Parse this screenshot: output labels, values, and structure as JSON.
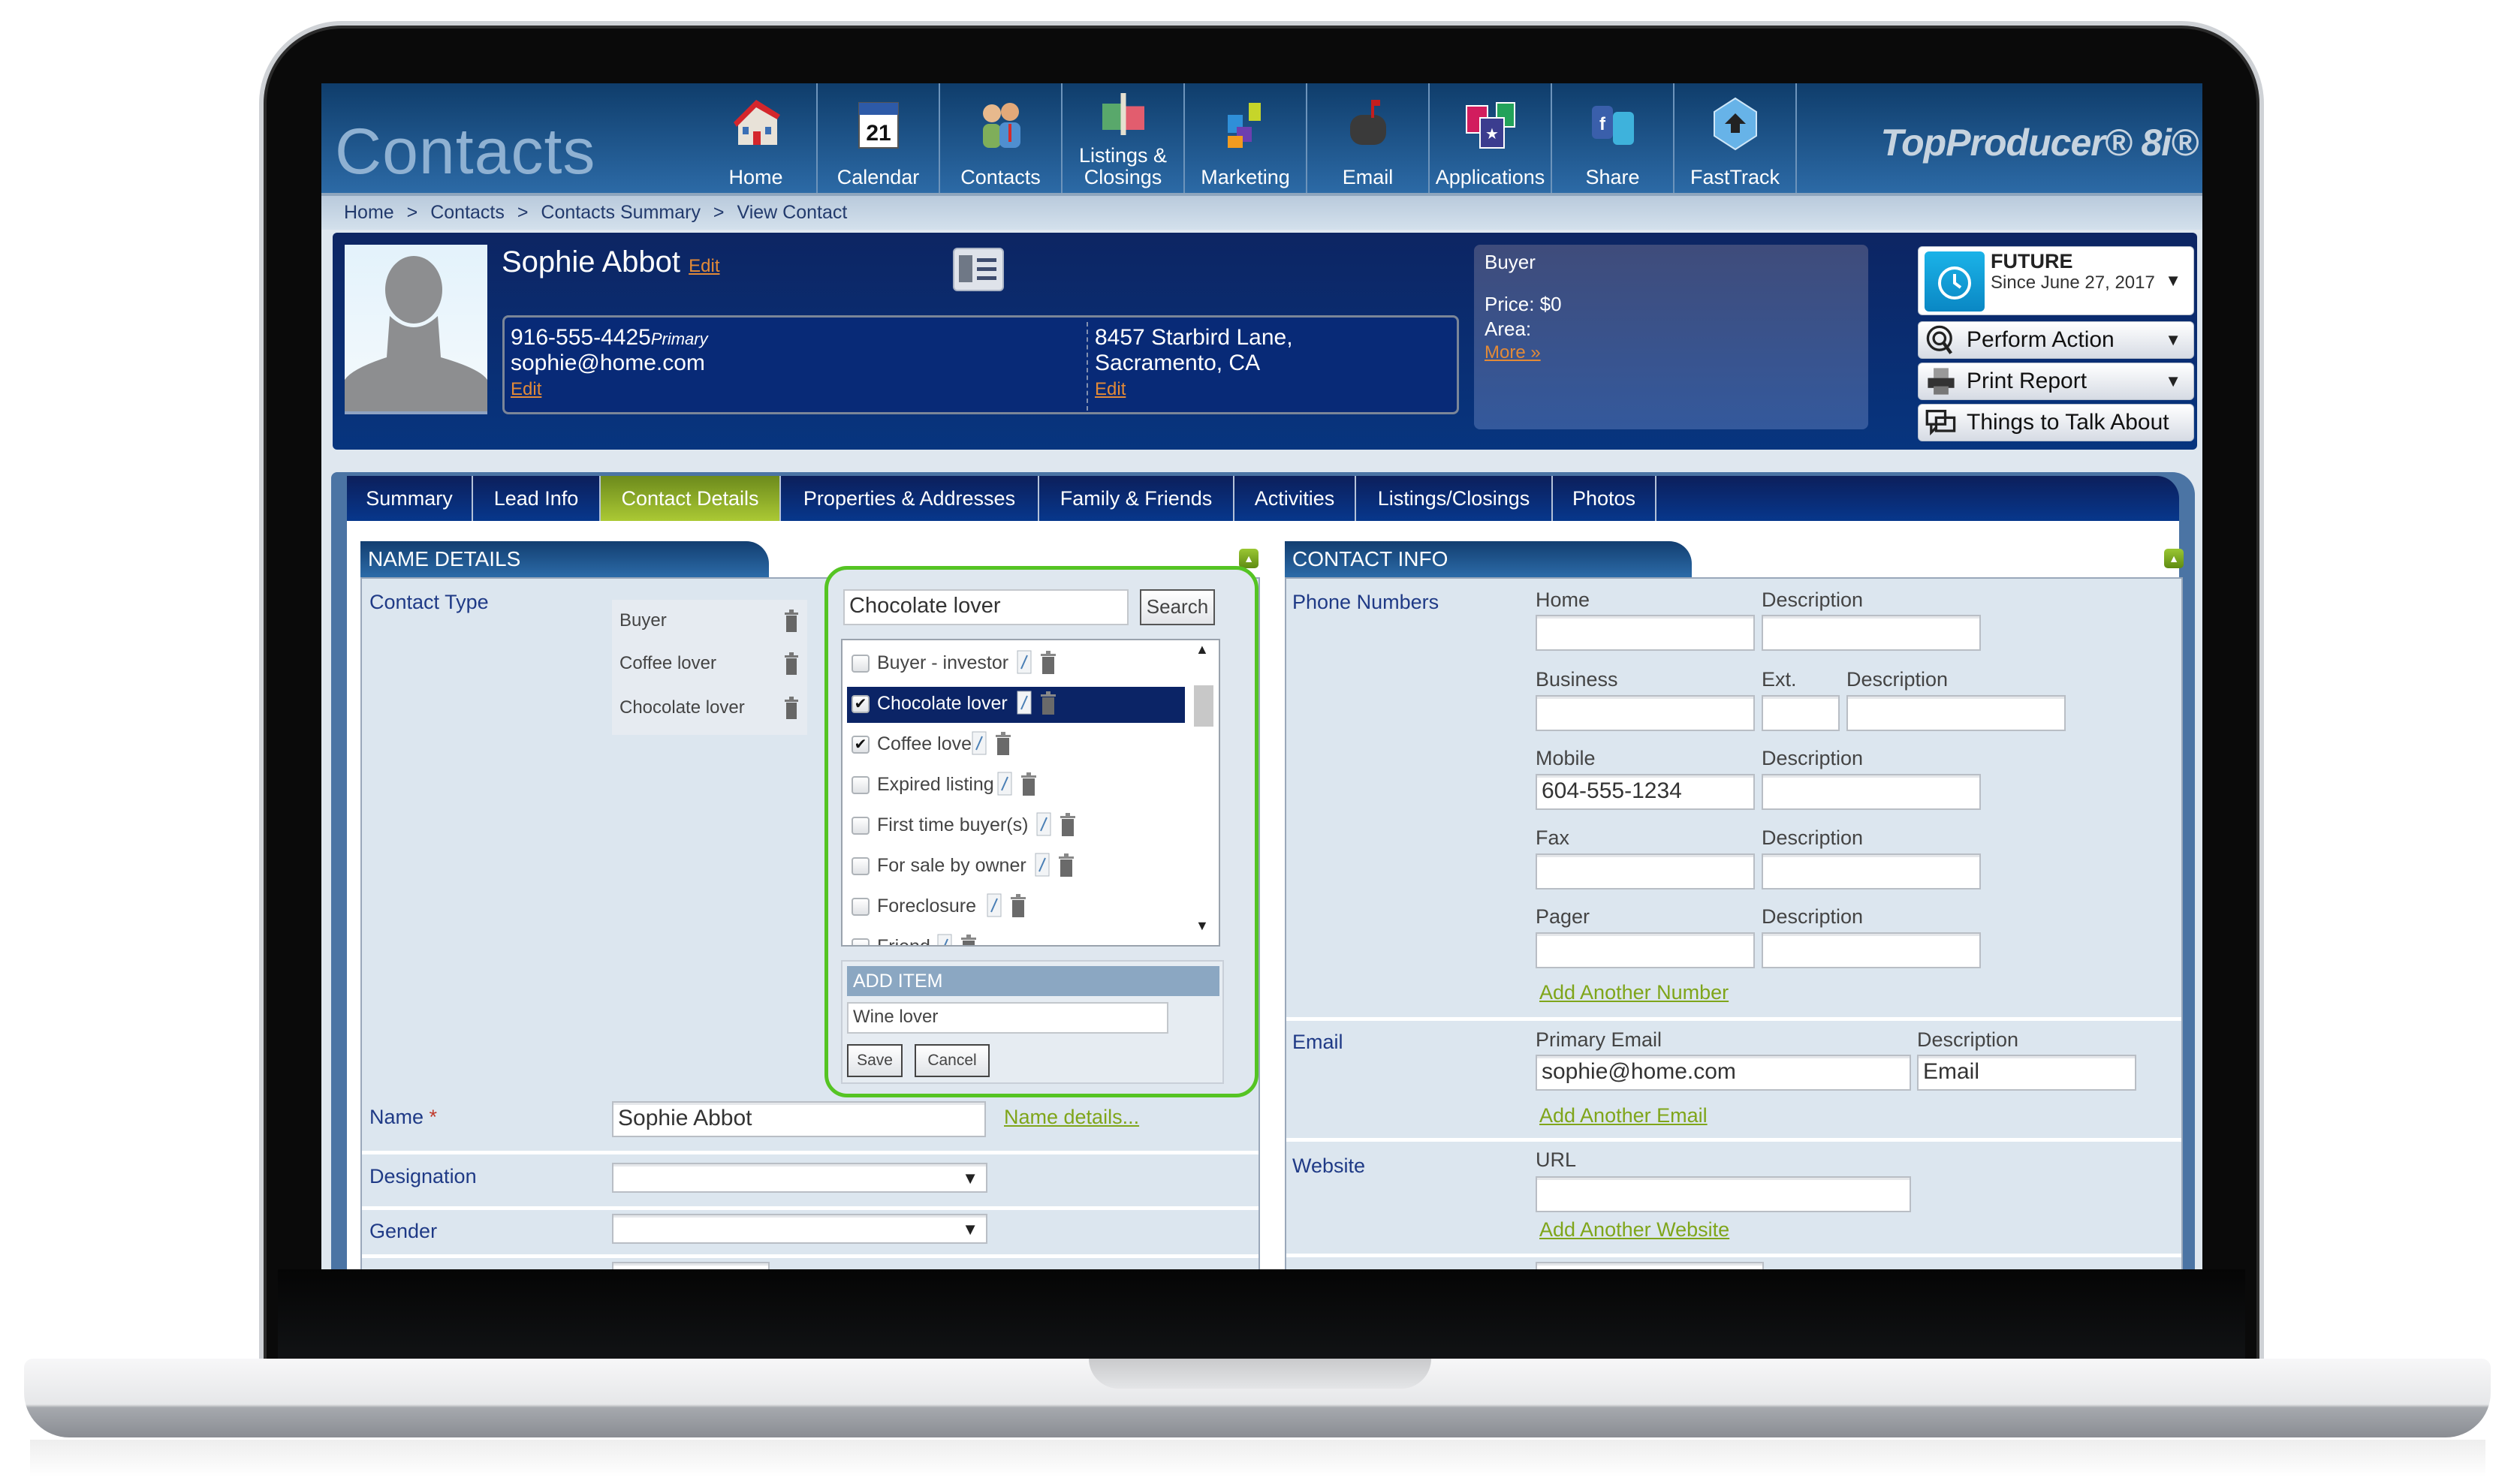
{
  "window": {
    "app_title": "Contacts",
    "brand": "TopProducer® 8i®"
  },
  "nav": {
    "items": [
      {
        "label": "Home",
        "icon": "house-icon",
        "active": true
      },
      {
        "label": "Calendar",
        "icon": "calendar-icon",
        "active": false,
        "icon_text": "21"
      },
      {
        "label": "Contacts",
        "icon": "people-icon",
        "active": true
      },
      {
        "label": "Listings &\nClosings",
        "icon": "sold-sign-icon",
        "active": false
      },
      {
        "label": "Marketing",
        "icon": "puzzle-icon",
        "active": false
      },
      {
        "label": "Email",
        "icon": "mailbox-icon",
        "active": false
      },
      {
        "label": "Applications",
        "icon": "apps-icon",
        "active": false
      },
      {
        "label": "Share",
        "icon": "social-share-icon",
        "active": false
      },
      {
        "label": "FastTrack",
        "icon": "fasttrack-icon",
        "active": false
      }
    ]
  },
  "breadcrumb": [
    "Home",
    "Contacts",
    "Contacts Summary",
    "View Contact"
  ],
  "breadcrumb_sep": ">",
  "contact": {
    "name": "Sophie Abbot",
    "edit_label": "Edit",
    "phone": "916-555-4425",
    "phone_tag": "Primary",
    "email": "sophie@home.com",
    "address_line1": "8457 Starbird Lane,",
    "address_line2": "Sacramento, CA"
  },
  "buyer_panel": {
    "type": "Buyer",
    "price": "Price: $0",
    "area": "Area:",
    "more_link": "More »"
  },
  "actions": {
    "status_title": "FUTURE",
    "status_since": "Since June 27, 2017",
    "perform_action": "Perform Action",
    "print_report": "Print Report",
    "things_to_talk": "Things to Talk About"
  },
  "tabs": [
    {
      "label": "Summary",
      "active": false
    },
    {
      "label": "Lead Info",
      "active": false
    },
    {
      "label": "Contact Details",
      "active": true
    },
    {
      "label": "Properties & Addresses",
      "active": false
    },
    {
      "label": "Family & Friends",
      "active": false
    },
    {
      "label": "Activities",
      "active": false
    },
    {
      "label": "Listings/Closings",
      "active": false
    },
    {
      "label": "Photos",
      "active": false
    }
  ],
  "name_details": {
    "header": "NAME DETAILS",
    "contact_type_label": "Contact Type",
    "contact_types": [
      "Buyer",
      "Coffee lover",
      "Chocolate lover"
    ],
    "name_label": "Name",
    "required_mark": "*",
    "name_value": "Sophie Abbot",
    "name_details_link": "Name details...",
    "designation_label": "Designation",
    "designation_value": "",
    "gender_label": "Gender",
    "gender_value": ""
  },
  "contact_type_popover": {
    "search_value": "Chocolate lover",
    "search_button": "Search",
    "items": [
      {
        "label": "Buyer - investor",
        "checked": false,
        "selected": false
      },
      {
        "label": "Chocolate lover",
        "checked": true,
        "selected": true
      },
      {
        "label": "Coffee lover",
        "checked": true,
        "selected": false
      },
      {
        "label": "Expired listing",
        "checked": false,
        "selected": false
      },
      {
        "label": "First time buyer(s)",
        "checked": false,
        "selected": false
      },
      {
        "label": "For sale by owner",
        "checked": false,
        "selected": false
      },
      {
        "label": "Foreclosure",
        "checked": false,
        "selected": false
      },
      {
        "label": "Friend",
        "checked": false,
        "selected": false
      }
    ],
    "add_item_header": "ADD ITEM",
    "add_item_value": "Wine lover",
    "save_button": "Save",
    "cancel_button": "Cancel"
  },
  "contact_info": {
    "header": "CONTACT INFO",
    "phone_section_label": "Phone Numbers",
    "phones": [
      {
        "type": "Home",
        "value": "",
        "description_label": "Description",
        "description": ""
      },
      {
        "type": "Business",
        "value": "",
        "ext_label": "Ext.",
        "ext": "",
        "description_label": "Description",
        "description": ""
      },
      {
        "type": "Mobile",
        "value": "604-555-1234",
        "description_label": "Description",
        "description": ""
      },
      {
        "type": "Fax",
        "value": "",
        "description_label": "Description",
        "description": ""
      },
      {
        "type": "Pager",
        "value": "",
        "description_label": "Description",
        "description": ""
      }
    ],
    "add_number_link": "Add Another Number",
    "email_section_label": "Email",
    "primary_email_label": "Primary Email",
    "primary_email_value": "sophie@home.com",
    "email_description_label": "Description",
    "email_description_value": "Email",
    "add_email_link": "Add Another Email",
    "website_section_label": "Website",
    "url_label": "URL",
    "url_value": "",
    "add_website_link": "Add Another Website"
  },
  "colors": {
    "nav_active_green": "#9cbf1f",
    "header_navy": "#0d2563",
    "link_orange": "#e38a37",
    "link_green": "#7fa51a",
    "highlight_outline": "#55c423",
    "selected_row": "#0b2466"
  }
}
